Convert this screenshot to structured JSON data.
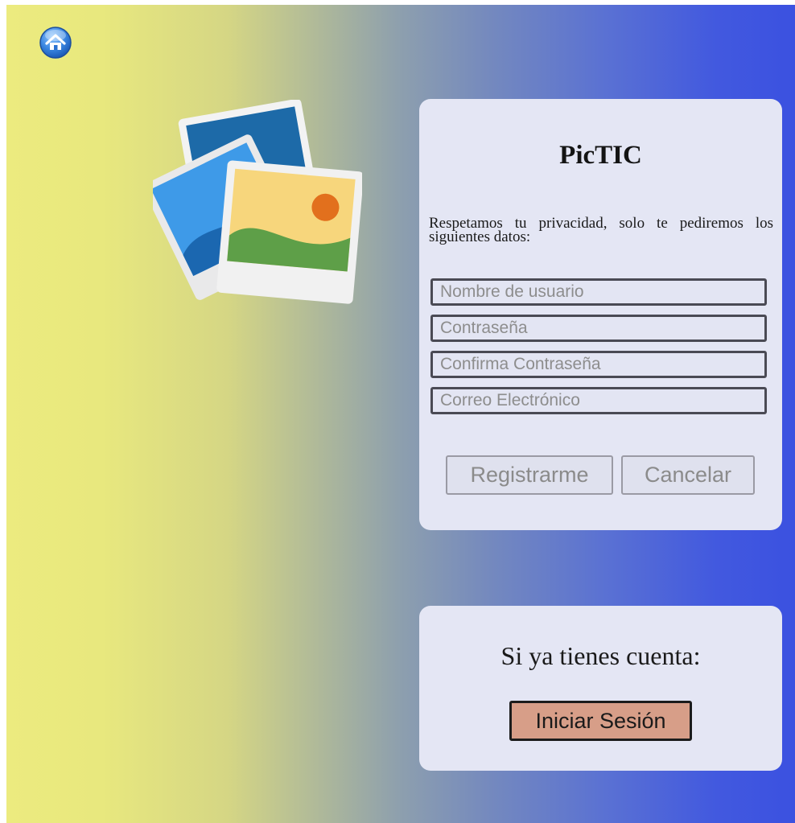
{
  "register": {
    "title": "PicTIC",
    "privacy_text": "Respetamos tu privacidad, solo te pediremos los siguientes datos:",
    "fields": [
      {
        "placeholder": "Nombre de usuario"
      },
      {
        "placeholder": "Contraseña"
      },
      {
        "placeholder": "Confirma Contraseña"
      },
      {
        "placeholder": "Correo Electrónico"
      }
    ],
    "register_label": "Registrarme",
    "cancel_label": "Cancelar"
  },
  "login": {
    "prompt": "Si ya tienes cuenta:",
    "button_label": "Iniciar Sesión"
  },
  "icons": {
    "home": "home-icon",
    "photos": "photos-icon"
  },
  "colors": {
    "gradient_left": "#ECEB7F",
    "gradient_right": "#3B51E0",
    "card_background": "#E4E6F4",
    "login_button": "#D79E88"
  }
}
